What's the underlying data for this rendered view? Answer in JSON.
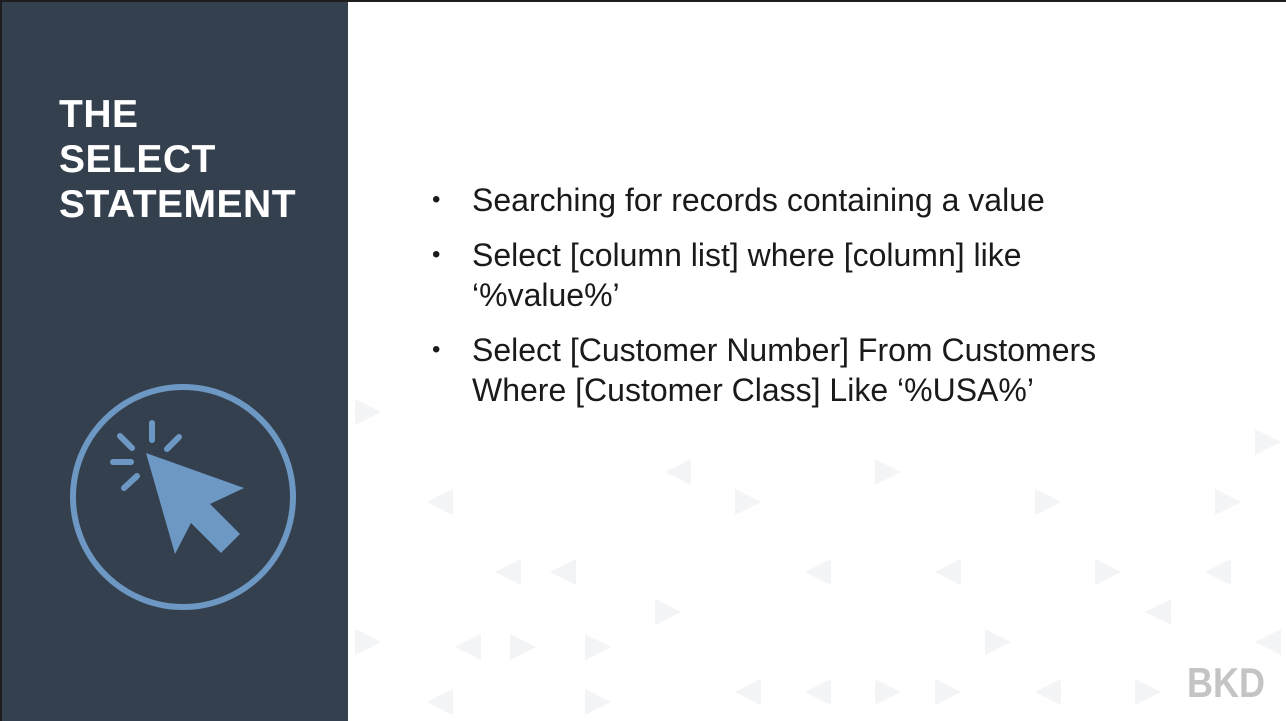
{
  "sidebar": {
    "title_lines": [
      "THE",
      "SELECT",
      "STATEMENT"
    ],
    "emblem_icon": "cursor-click-icon",
    "background_color": "#35404f",
    "emblem_color": "#6c98c3"
  },
  "content": {
    "bullet_symbol": "•",
    "bullets": [
      {
        "lines": [
          "Searching for records containing a value"
        ]
      },
      {
        "lines": [
          "Select [column list] where [column] like",
          "‘%value%’"
        ]
      },
      {
        "lines": [
          "Select [Customer Number] From Customers",
          "Where [Customer Class] Like ‘%USA%’"
        ]
      }
    ]
  },
  "logo": {
    "text": "BKD",
    "color": "#c4c4c4"
  }
}
